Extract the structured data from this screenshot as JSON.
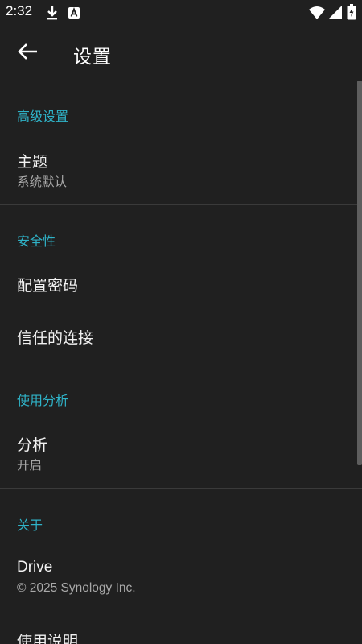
{
  "status_bar": {
    "time": "2:32",
    "icons": [
      "download-icon",
      "a-badge-icon",
      "wifi-icon",
      "signal-icon",
      "battery-charging-icon"
    ]
  },
  "app_bar": {
    "title": "设置",
    "back_icon": "arrow-left-icon"
  },
  "sections": [
    {
      "header": "高级设置",
      "items": [
        {
          "title": "主题",
          "summary": "系统默认"
        }
      ]
    },
    {
      "header": "安全性",
      "items": [
        {
          "title": "配置密码"
        },
        {
          "title": "信任的连接"
        }
      ]
    },
    {
      "header": "使用分析",
      "items": [
        {
          "title": "分析",
          "summary": "开启"
        }
      ]
    },
    {
      "header": "关于",
      "items": [
        {
          "title": "Drive",
          "summary": "© 2025 Synology Inc."
        },
        {
          "title": "使用说明"
        }
      ]
    }
  ],
  "colors": {
    "background": "#202020",
    "accent": "#2fb3c8",
    "divider": "#3a3a3a"
  }
}
